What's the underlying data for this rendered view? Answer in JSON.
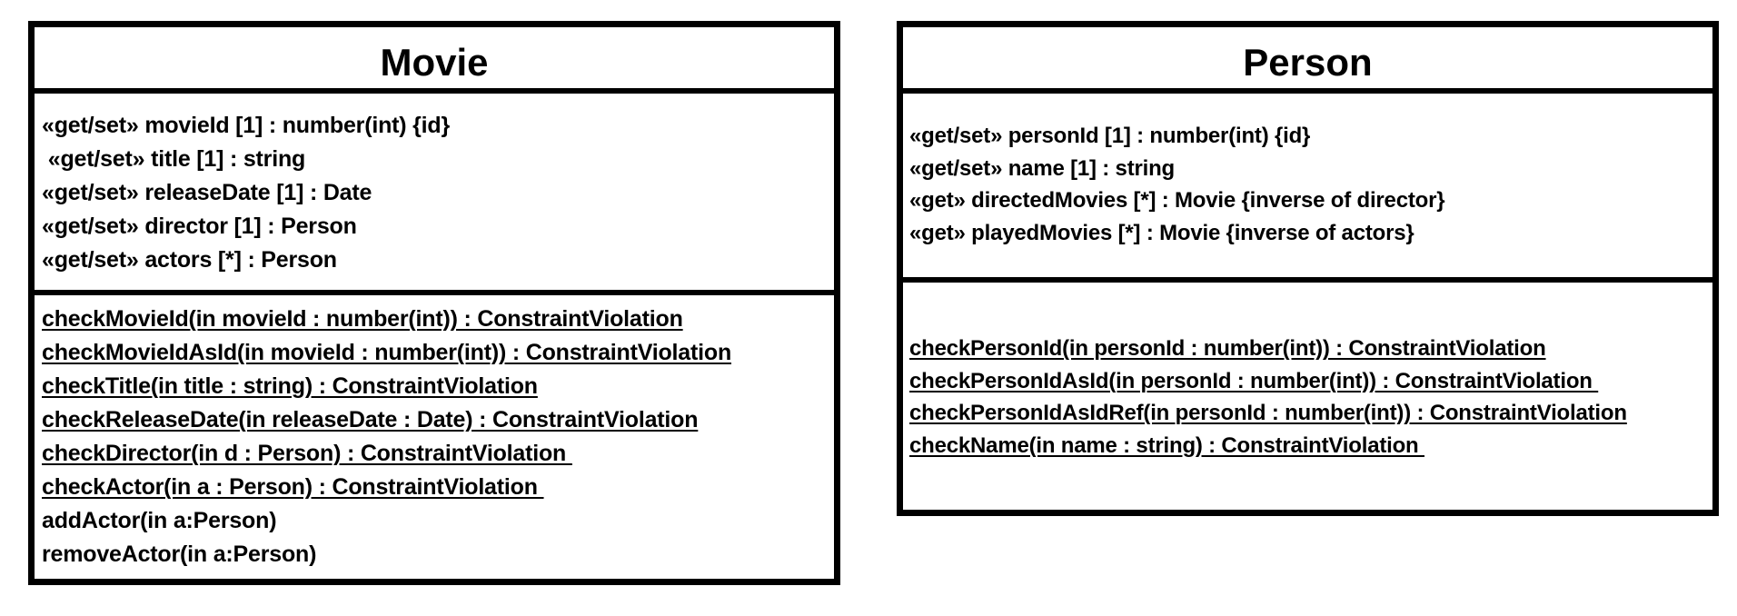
{
  "classes": [
    {
      "name": "Movie",
      "attributes": [
        "«get/set» movieId [1] : number(int) {id}",
        " «get/set» title [1] : string",
        "«get/set» releaseDate [1] : Date",
        "«get/set» director [1] : Person",
        "«get/set» actors [*] : Person"
      ],
      "operations": [
        {
          "text": "checkMovieId(in movieId : number(int)) : ConstraintViolation",
          "static": true
        },
        {
          "text": "checkMovieIdAsId(in movieId : number(int)) : ConstraintViolation",
          "static": true
        },
        {
          "text": "checkTitle(in title : string) : ConstraintViolation",
          "static": true
        },
        {
          "text": "checkReleaseDate(in releaseDate : Date) : ConstraintViolation",
          "static": true
        },
        {
          "text": "checkDirector(in d : Person) : ConstraintViolation ",
          "static": true
        },
        {
          "text": "checkActor(in a : Person) : ConstraintViolation ",
          "static": true
        },
        {
          "text": "addActor(in a:Person)",
          "static": false
        },
        {
          "text": "removeActor(in a:Person)",
          "static": false
        }
      ]
    },
    {
      "name": "Person",
      "attributes": [
        "«get/set» personId [1] : number(int) {id}",
        "«get/set» name [1] : string",
        "«get» directedMovies [*] : Movie {inverse of director}",
        "«get» playedMovies [*] : Movie {inverse of actors}"
      ],
      "operations": [
        {
          "text": "checkPersonId(in personId : number(int)) : ConstraintViolation",
          "static": true
        },
        {
          "text": "checkPersonIdAsId(in personId : number(int)) : ConstraintViolation ",
          "static": true
        },
        {
          "text": "checkPersonIdAsIdRef(in personId : number(int)) : ConstraintViolation",
          "static": true
        },
        {
          "text": "checkName(in name : string) : ConstraintViolation ",
          "static": true
        }
      ]
    }
  ]
}
